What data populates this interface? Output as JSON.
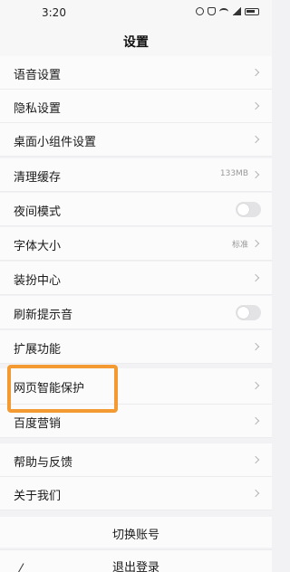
{
  "status_bar": {
    "time": "3:20",
    "icons": [
      "alarm-icon",
      "mute-icon",
      "wifi-icon",
      "signal-icon",
      "battery-icon"
    ]
  },
  "header": {
    "title": "设置"
  },
  "settings": [
    {
      "label": "语音设置",
      "control": "chevron"
    },
    {
      "label": "隐私设置",
      "control": "chevron"
    },
    {
      "label": "桌面小组件设置",
      "control": "chevron"
    },
    {
      "label": "清理缓存",
      "value": "133MB",
      "control": "chevron"
    },
    {
      "label": "夜间模式",
      "control": "toggle",
      "toggle_on": false
    },
    {
      "label": "字体大小",
      "value": "标准",
      "control": "chevron"
    },
    {
      "label": "装扮中心",
      "control": "chevron"
    },
    {
      "label": "刷新提示音",
      "control": "toggle",
      "toggle_on": false
    },
    {
      "label": "扩展功能",
      "control": "chevron"
    },
    {
      "label": "网页智能保护",
      "control": "chevron",
      "highlighted": true
    },
    {
      "label": "百度营销",
      "control": "chevron"
    },
    {
      "label": "帮助与反馈",
      "control": "chevron"
    },
    {
      "label": "关于我们",
      "control": "chevron"
    }
  ],
  "actions": {
    "switch_account": "切换账号",
    "logout": "退出登录"
  },
  "colors": {
    "background": "#f2f2f4",
    "row": "#fbfbfc",
    "highlight": "#f39a33",
    "chevron": "#b5b5b5"
  }
}
